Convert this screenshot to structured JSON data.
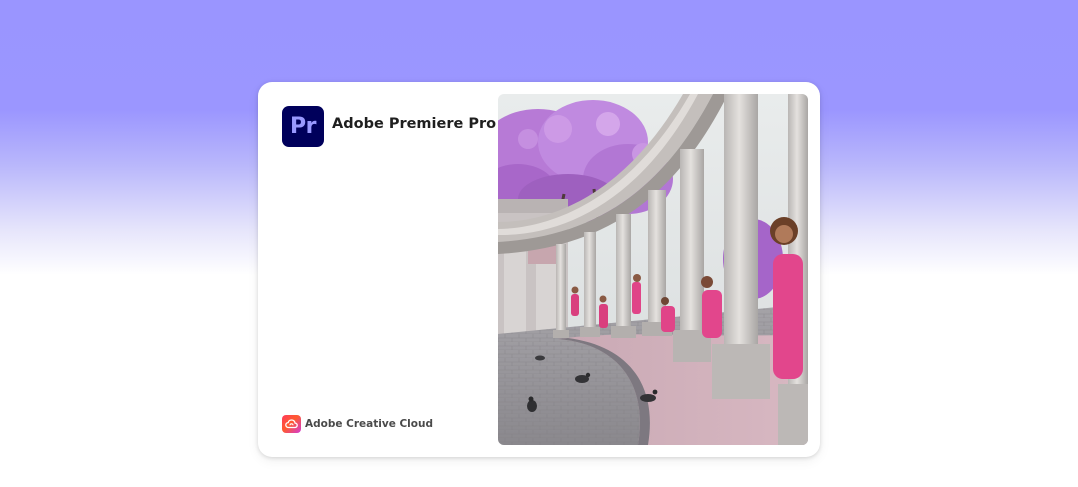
{
  "app": {
    "logo_text": "Pr",
    "name": "Adobe Premiere Pro",
    "brand_color": "#00005b",
    "logo_text_color": "#9999ff"
  },
  "footer": {
    "label": "Adobe Creative Cloud",
    "icon": "creative-cloud-icon"
  },
  "hero_image": {
    "subject": "colonnade-with-figures-in-pink"
  },
  "colors": {
    "background_top": "#9b96ff",
    "background_bottom": "#ffffff",
    "card": "#ffffff"
  }
}
